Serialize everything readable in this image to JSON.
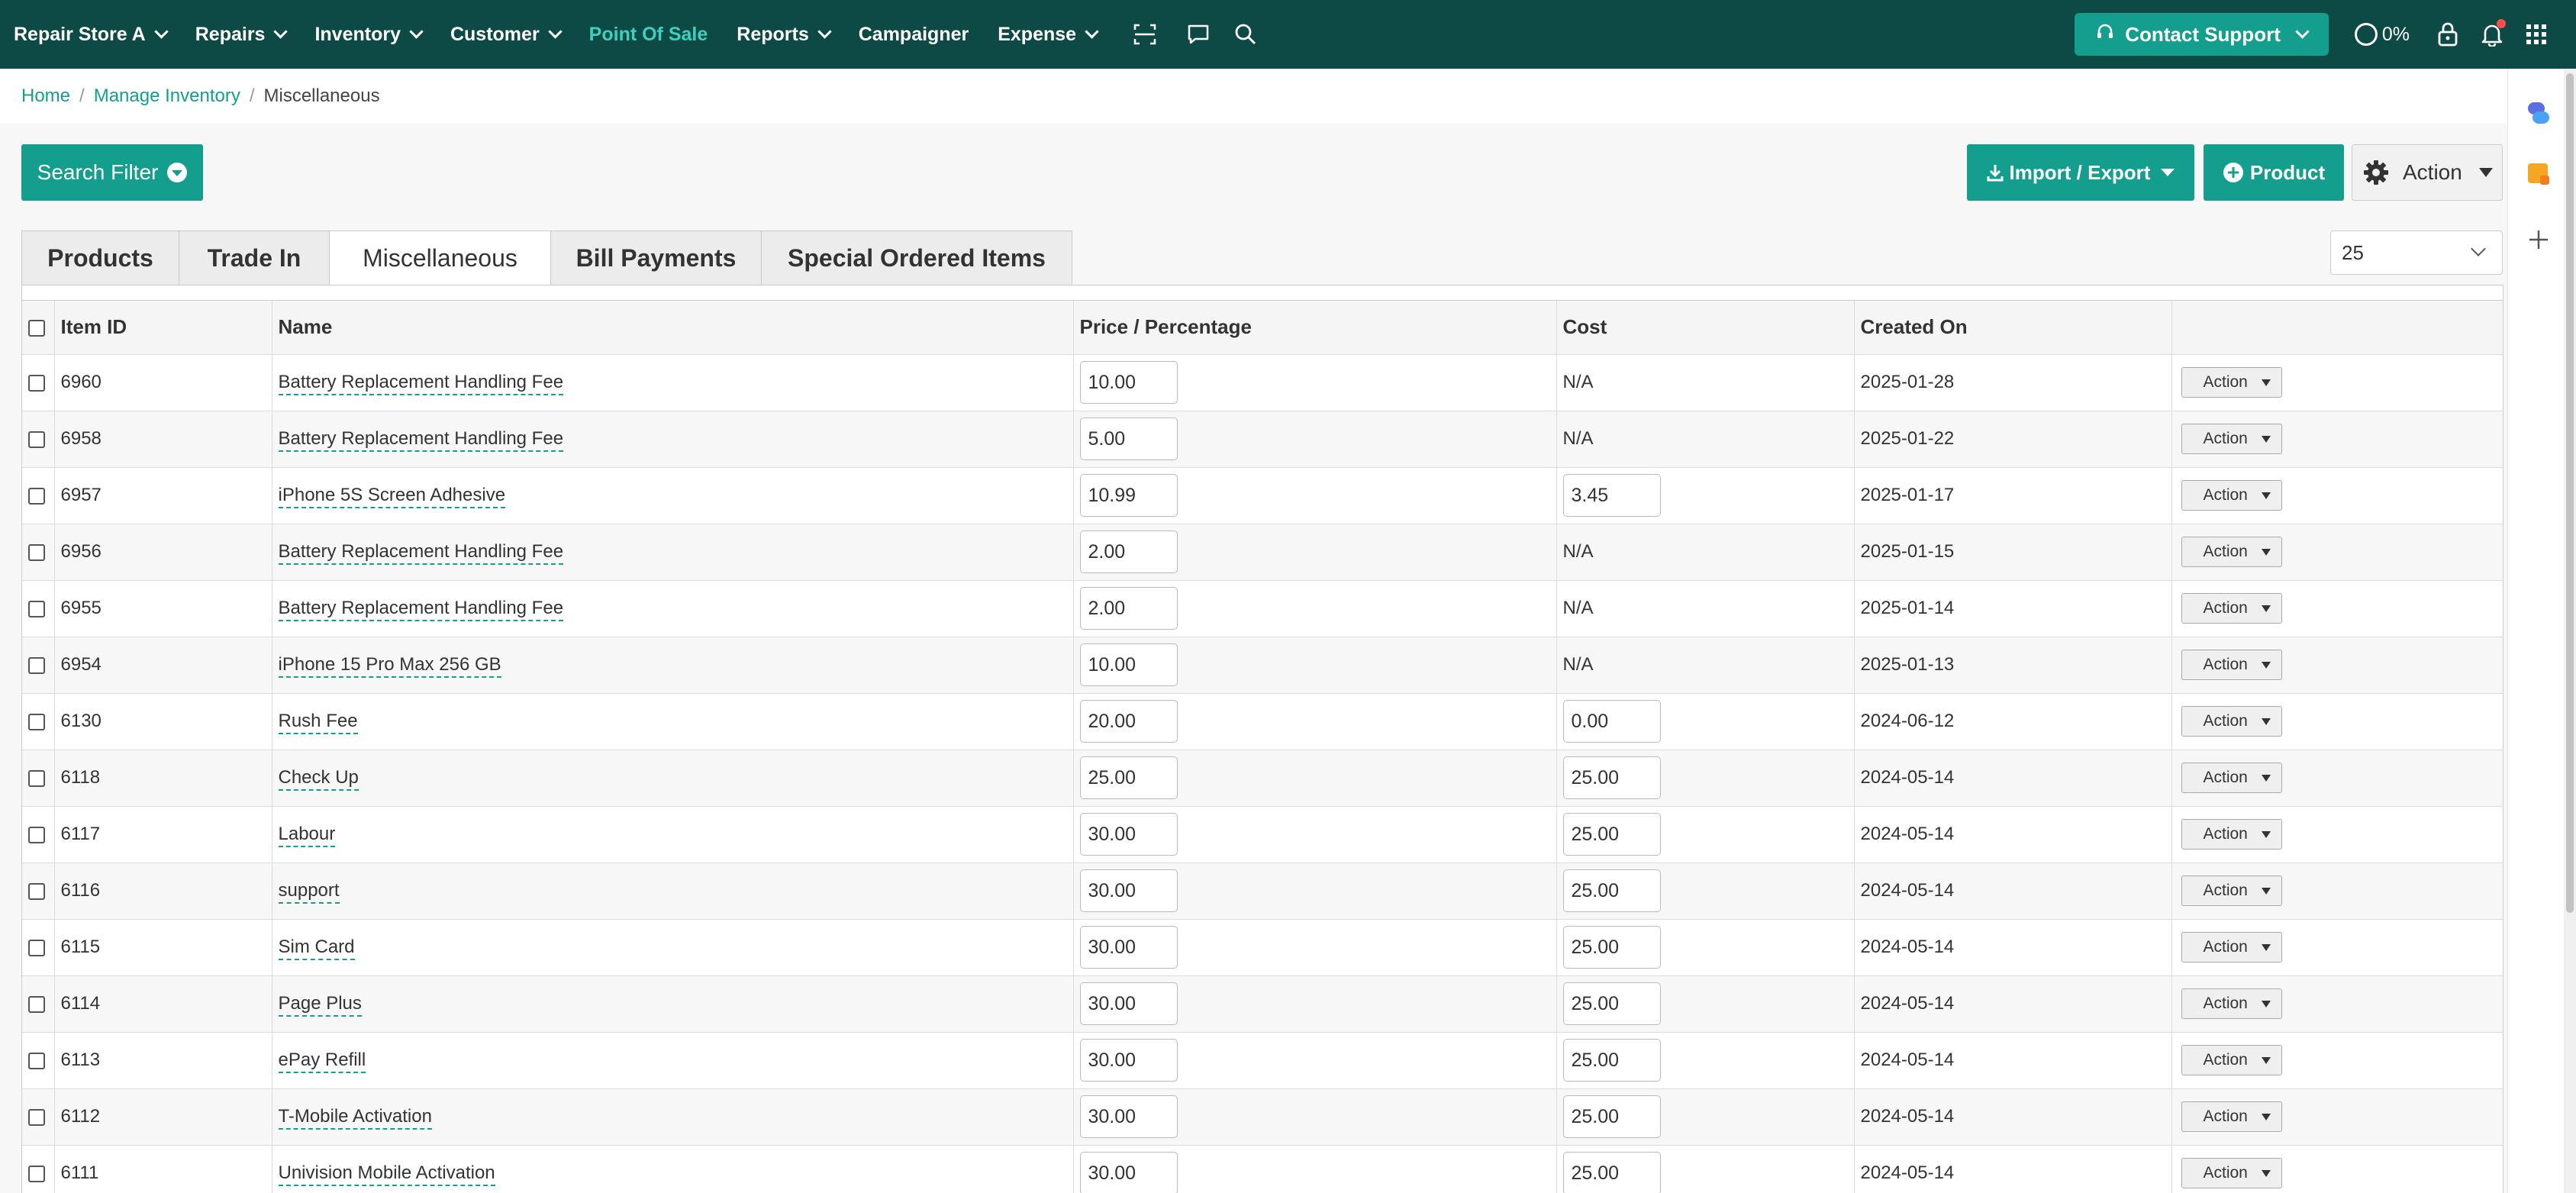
{
  "nav": {
    "items": [
      {
        "label": "Repair Store A",
        "chevron": true,
        "active": false,
        "name": "nav-store-selector"
      },
      {
        "label": "Repairs",
        "chevron": true,
        "active": false,
        "name": "nav-repairs"
      },
      {
        "label": "Inventory",
        "chevron": true,
        "active": false,
        "name": "nav-inventory"
      },
      {
        "label": "Customer",
        "chevron": true,
        "active": false,
        "name": "nav-customer"
      },
      {
        "label": "Point Of Sale",
        "chevron": false,
        "active": true,
        "name": "nav-point-of-sale"
      },
      {
        "label": "Reports",
        "chevron": true,
        "active": false,
        "name": "nav-reports"
      },
      {
        "label": "Campaigner",
        "chevron": false,
        "active": false,
        "name": "nav-campaigner"
      },
      {
        "label": "Expense",
        "chevron": true,
        "active": false,
        "name": "nav-expense"
      }
    ],
    "contact_support": "Contact Support",
    "progress": "0%",
    "active_color": "#3ed0bf",
    "bar_color": "#0d4a45"
  },
  "breadcrumb": {
    "home": "Home",
    "manage_inventory": "Manage Inventory",
    "current": "Miscellaneous",
    "separator": "/"
  },
  "toolbar": {
    "search_filter": "Search Filter",
    "import_export": "Import / Export",
    "product": "Product",
    "action": "Action",
    "accent_color": "#149e8e"
  },
  "tabs": [
    {
      "label": "Products",
      "active": false,
      "name": "tab-products"
    },
    {
      "label": "Trade In",
      "active": false,
      "name": "tab-trade-in"
    },
    {
      "label": "Miscellaneous",
      "active": true,
      "name": "tab-miscellaneous"
    },
    {
      "label": "Bill Payments",
      "active": false,
      "name": "tab-bill-payments"
    },
    {
      "label": "Special Ordered Items",
      "active": false,
      "name": "tab-special-ordered-items"
    }
  ],
  "per_page": "25",
  "table": {
    "headers": {
      "item_id": "Item ID",
      "name": "Name",
      "price": "Price / Percentage",
      "cost": "Cost",
      "created_on": "Created On"
    },
    "action_label": "Action",
    "rows": [
      {
        "id": "6960",
        "name": "Battery Replacement Handling Fee",
        "price": "10.00",
        "cost": "N/A",
        "cost_editable": false,
        "created": "2025-01-28"
      },
      {
        "id": "6958",
        "name": "Battery Replacement Handling Fee",
        "price": "5.00",
        "cost": "N/A",
        "cost_editable": false,
        "created": "2025-01-22"
      },
      {
        "id": "6957",
        "name": "iPhone 5S Screen Adhesive",
        "price": "10.99",
        "cost": "3.45",
        "cost_editable": true,
        "created": "2025-01-17"
      },
      {
        "id": "6956",
        "name": "Battery Replacement Handling Fee",
        "price": "2.00",
        "cost": "N/A",
        "cost_editable": false,
        "created": "2025-01-15"
      },
      {
        "id": "6955",
        "name": "Battery Replacement Handling Fee",
        "price": "2.00",
        "cost": "N/A",
        "cost_editable": false,
        "created": "2025-01-14"
      },
      {
        "id": "6954",
        "name": "iPhone 15 Pro Max 256 GB",
        "price": "10.00",
        "cost": "N/A",
        "cost_editable": false,
        "created": "2025-01-13"
      },
      {
        "id": "6130",
        "name": "Rush Fee",
        "price": "20.00",
        "cost": "0.00",
        "cost_editable": true,
        "created": "2024-06-12"
      },
      {
        "id": "6118",
        "name": "Check Up",
        "price": "25.00",
        "cost": "25.00",
        "cost_editable": true,
        "created": "2024-05-14"
      },
      {
        "id": "6117",
        "name": "Labour",
        "price": "30.00",
        "cost": "25.00",
        "cost_editable": true,
        "created": "2024-05-14"
      },
      {
        "id": "6116",
        "name": "support",
        "price": "30.00",
        "cost": "25.00",
        "cost_editable": true,
        "created": "2024-05-14"
      },
      {
        "id": "6115",
        "name": "Sim Card",
        "price": "30.00",
        "cost": "25.00",
        "cost_editable": true,
        "created": "2024-05-14"
      },
      {
        "id": "6114",
        "name": "Page Plus",
        "price": "30.00",
        "cost": "25.00",
        "cost_editable": true,
        "created": "2024-05-14"
      },
      {
        "id": "6113",
        "name": "ePay Refill",
        "price": "30.00",
        "cost": "25.00",
        "cost_editable": true,
        "created": "2024-05-14"
      },
      {
        "id": "6112",
        "name": "T-Mobile Activation",
        "price": "30.00",
        "cost": "25.00",
        "cost_editable": true,
        "created": "2024-05-14"
      },
      {
        "id": "6111",
        "name": "Univision Mobile Activation",
        "price": "30.00",
        "cost": "25.00",
        "cost_editable": true,
        "created": "2024-05-14"
      }
    ]
  }
}
